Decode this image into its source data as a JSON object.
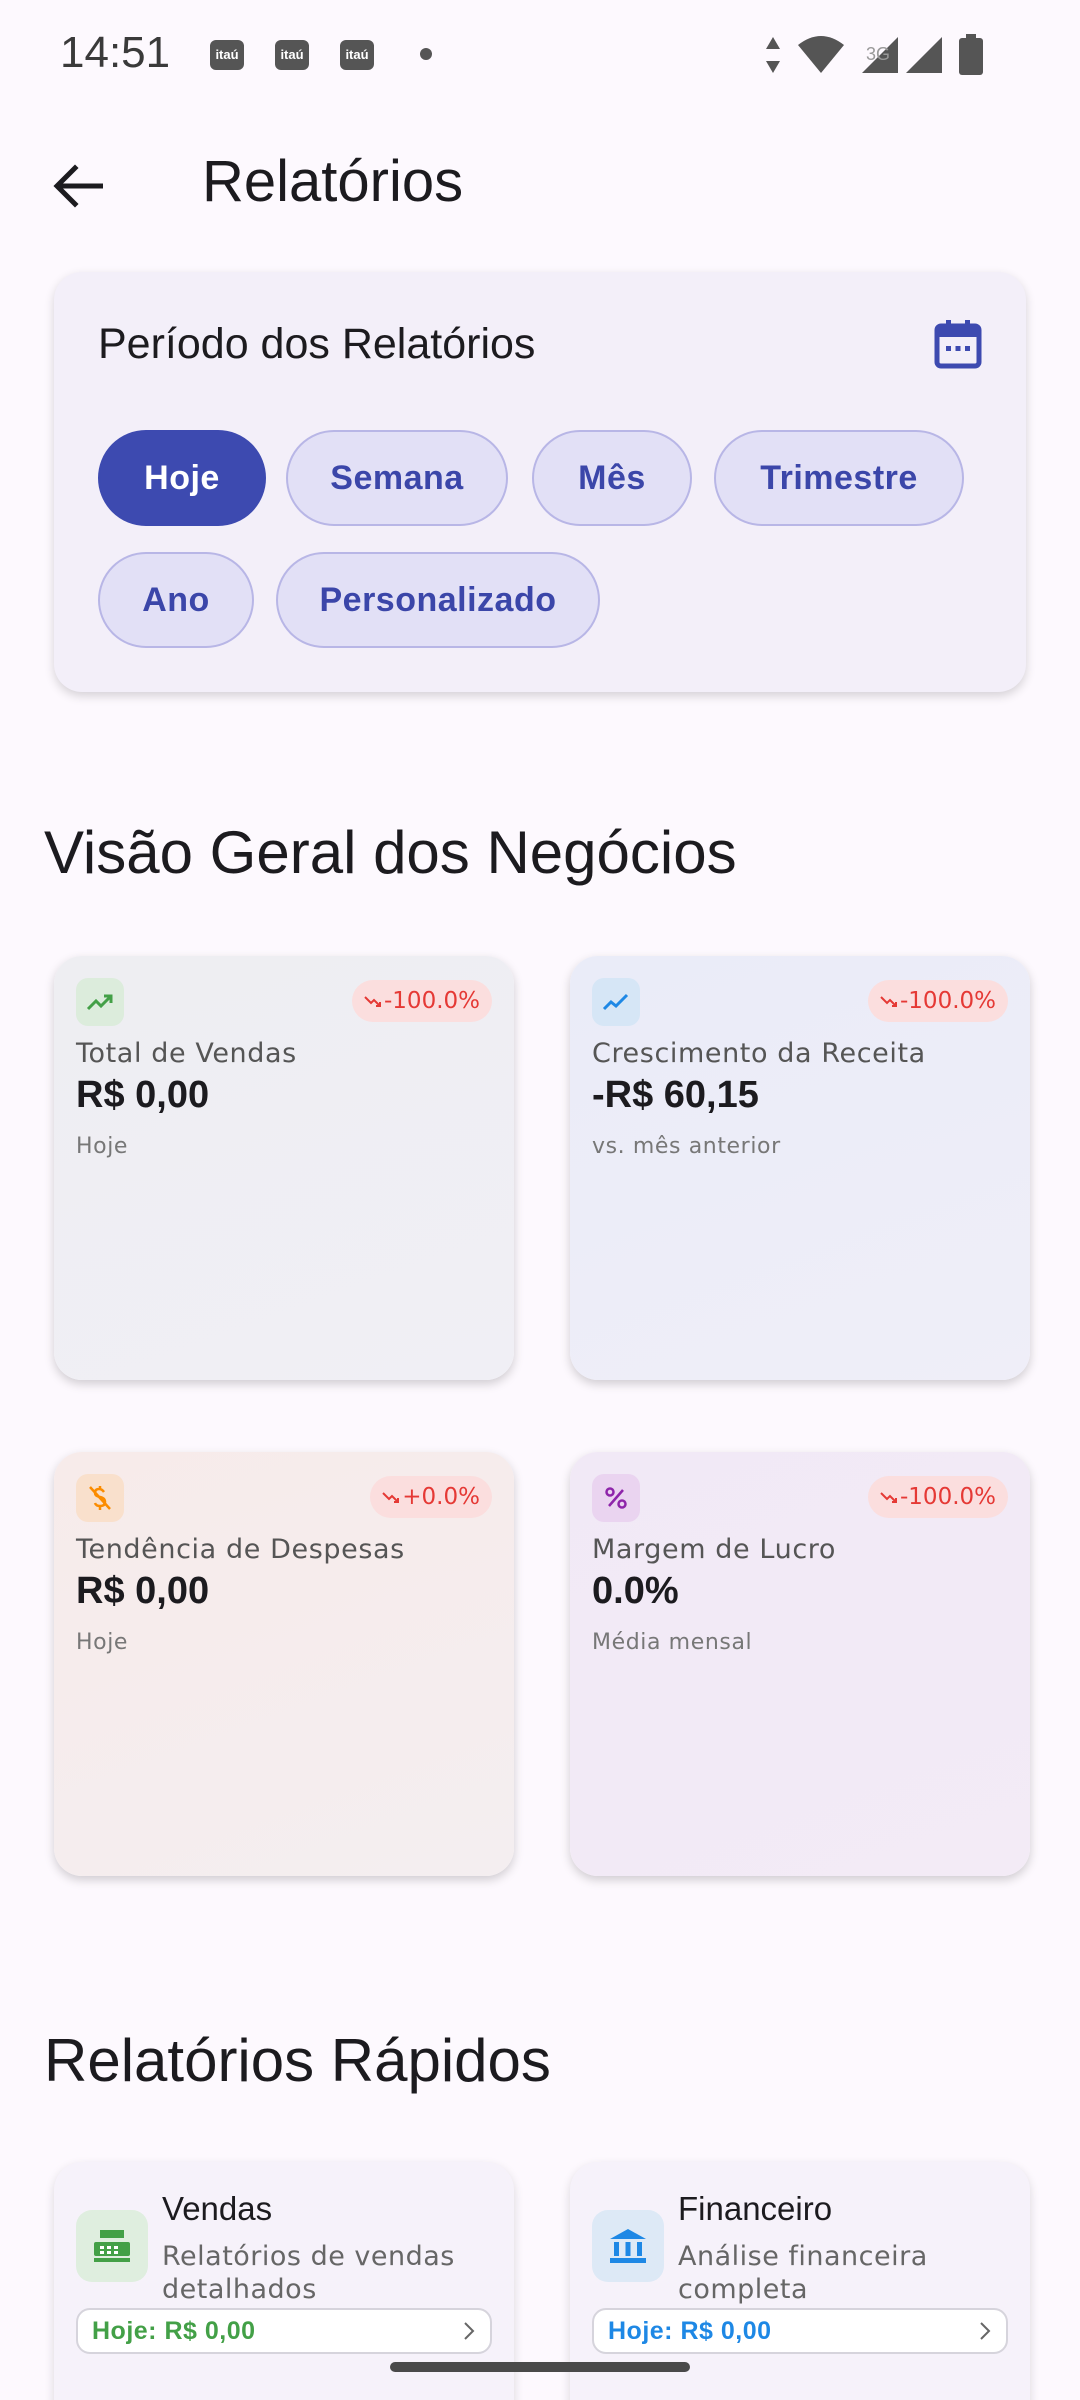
{
  "status_bar": {
    "time": "14:51",
    "notification_icons": [
      "itaú",
      "itaú",
      "itaú"
    ]
  },
  "app_bar": {
    "title": "Relatórios",
    "back_icon": "arrow-back-icon"
  },
  "period": {
    "title": "Período dos Relatórios",
    "calendar_icon": "calendar-icon",
    "chips": [
      {
        "label": "Hoje",
        "selected": true
      },
      {
        "label": "Semana",
        "selected": false
      },
      {
        "label": "Mês",
        "selected": false
      },
      {
        "label": "Trimestre",
        "selected": false
      },
      {
        "label": "Ano",
        "selected": false
      },
      {
        "label": "Personalizado",
        "selected": false
      }
    ]
  },
  "overview": {
    "title": "Visão Geral dos Negócios",
    "cards": [
      {
        "icon": "trending-up-icon",
        "badge": "-100.0%",
        "label": "Total de Vendas",
        "value": "R$ 0,00",
        "sub": "Hoje"
      },
      {
        "icon": "show-chart-icon",
        "badge": "-100.0%",
        "label": "Crescimento da Receita",
        "value": "-R$ 60,15",
        "sub": "vs. mês anterior"
      },
      {
        "icon": "money-off-icon",
        "badge": "+0.0%",
        "label": "Tendência de Despesas",
        "value": "R$ 0,00",
        "sub": "Hoje"
      },
      {
        "icon": "percent-icon",
        "badge": "-100.0%",
        "label": "Margem de Lucro",
        "value": "0.0%",
        "sub": "Média mensal"
      }
    ]
  },
  "quick": {
    "title": "Relatórios Rápidos",
    "cards": [
      {
        "icon": "point-of-sale-icon",
        "title": "Vendas",
        "desc": "Relatórios de vendas detalhados",
        "pill": "Hoje: R$ 0,00"
      },
      {
        "icon": "bank-icon",
        "title": "Financeiro",
        "desc": "Análise financeira completa",
        "pill": "Hoje: R$ 0,00"
      }
    ]
  },
  "colors": {
    "primary": "#3d4ab0",
    "chip_bg": "#e2e0f6",
    "negative": "#e53935",
    "sales_green": "#43a047",
    "finance_blue": "#1e88e5"
  }
}
